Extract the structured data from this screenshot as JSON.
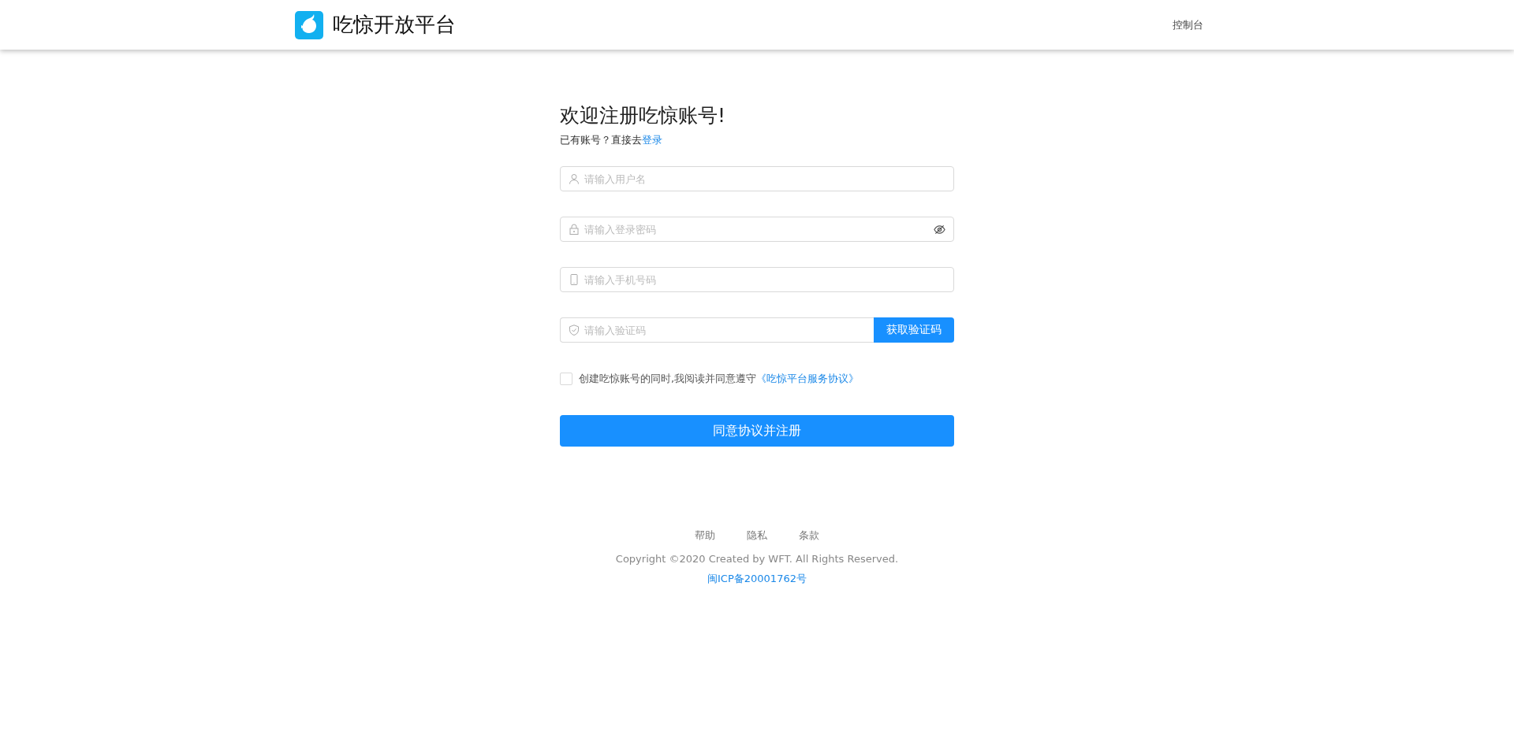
{
  "header": {
    "brand": "吃惊开放平台",
    "nav": [
      {
        "label": "控制台",
        "selected": false
      }
    ]
  },
  "form": {
    "title": "欢迎注册吃惊账号!",
    "subtitle": "已有账号？直接去",
    "login_link": "登录",
    "fields": [
      {
        "kind": "user",
        "placeholder": "请输入用户名"
      },
      {
        "kind": "password",
        "placeholder": "请输入登录密码"
      },
      {
        "kind": "phone",
        "placeholder": "请输入手机号码"
      },
      {
        "kind": "code",
        "placeholder": "请输入验证码",
        "button": "获取验证码"
      }
    ],
    "agreement": {
      "checked": false,
      "text": "创建吃惊账号的同时,我阅读并同意遵守",
      "link": "《吃惊平台服务协议》"
    },
    "submit": "同意协议并注册"
  },
  "footer": {
    "links": [
      "帮助",
      "隐私",
      "条款"
    ],
    "copyright": "Copyright ©2020 Created by WFT. All Rights Reserved.",
    "icp": "闽ICP备20001762号"
  }
}
